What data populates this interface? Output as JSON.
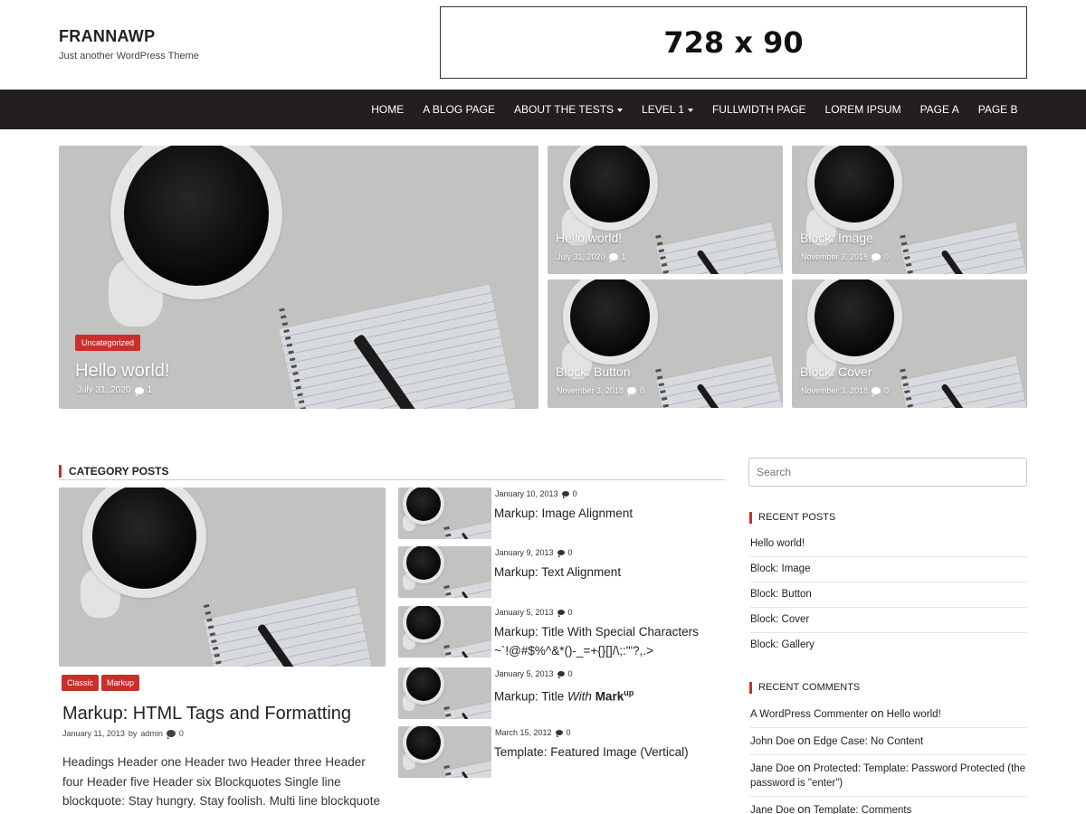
{
  "site": {
    "title": "FRANNAWP",
    "description": "Just another WordPress Theme",
    "ad_text": "728 x 90"
  },
  "nav": {
    "items": [
      {
        "label": "HOME",
        "dropdown": false
      },
      {
        "label": "A BLOG PAGE",
        "dropdown": false
      },
      {
        "label": "ABOUT THE TESTS",
        "dropdown": true
      },
      {
        "label": "LEVEL 1",
        "dropdown": true
      },
      {
        "label": "FULLWIDTH PAGE",
        "dropdown": false
      },
      {
        "label": "LOREM IPSUM",
        "dropdown": false
      },
      {
        "label": "PAGE A",
        "dropdown": false
      },
      {
        "label": "PAGE B",
        "dropdown": false
      }
    ]
  },
  "featured": {
    "main": {
      "category": "Uncategorized",
      "title": "Hello world!",
      "date": "July 31, 2020",
      "comments": "1"
    },
    "tiles": [
      {
        "title": "Hello world!",
        "date": "July 31, 2020",
        "comments": "1"
      },
      {
        "title": "Block: Image",
        "date": "November 3, 2018",
        "comments": "0"
      },
      {
        "title": "Block: Button",
        "date": "November 3, 2018",
        "comments": "0"
      },
      {
        "title": "Block: Cover",
        "date": "November 3, 2018",
        "comments": "0"
      }
    ]
  },
  "category_posts": {
    "heading": "CATEGORY POSTS",
    "main": {
      "badges": [
        "Classic",
        "Markup"
      ],
      "title": "Markup: HTML Tags and Formatting",
      "date": "January 11, 2013",
      "by": "by",
      "author": "admin",
      "comments": "0",
      "excerpt": "Headings Header one Header two Header three Header four Header five Header six Blockquotes Single line blockquote: Stay hungry. Stay foolish. Multi line blockquote with a cite reference: The HTML"
    },
    "list": [
      {
        "date": "January 10, 2013",
        "comments": "0",
        "title": "Markup: Image Alignment"
      },
      {
        "date": "January 9, 2013",
        "comments": "0",
        "title": "Markup: Text Alignment"
      },
      {
        "date": "January 5, 2013",
        "comments": "0",
        "title": "Markup: Title With Special Characters ~`!@#$%^&*()-_=+{}[]/\\;:'\"?,.>"
      },
      {
        "date": "January 5, 2013",
        "comments": "0",
        "title_prefix": "Markup: Title ",
        "title_em": "With",
        "title_bold": "Mark",
        "title_sup": "up"
      },
      {
        "date": "March 15, 2012",
        "comments": "0",
        "title": "Template: Featured Image (Vertical)"
      }
    ]
  },
  "sidebar": {
    "search_placeholder": "Search",
    "recent_posts_title": "RECENT POSTS",
    "recent_posts": [
      "Hello world!",
      "Block: Image",
      "Block: Button",
      "Block: Cover",
      "Block: Gallery"
    ],
    "recent_comments_title": "RECENT COMMENTS",
    "on_word": "on",
    "recent_comments": [
      {
        "author": "A WordPress Commenter",
        "post": "Hello world!"
      },
      {
        "author": "John Doe",
        "post": "Edge Case: No Content"
      },
      {
        "author": "Jane Doe",
        "post": "Protected: Template: Password Protected (the password is \"enter\")"
      },
      {
        "author": "Jane Doe",
        "post": "Template: Comments"
      }
    ]
  },
  "colors": {
    "accent": "#c9302c",
    "nav_bg": "#231f20"
  }
}
